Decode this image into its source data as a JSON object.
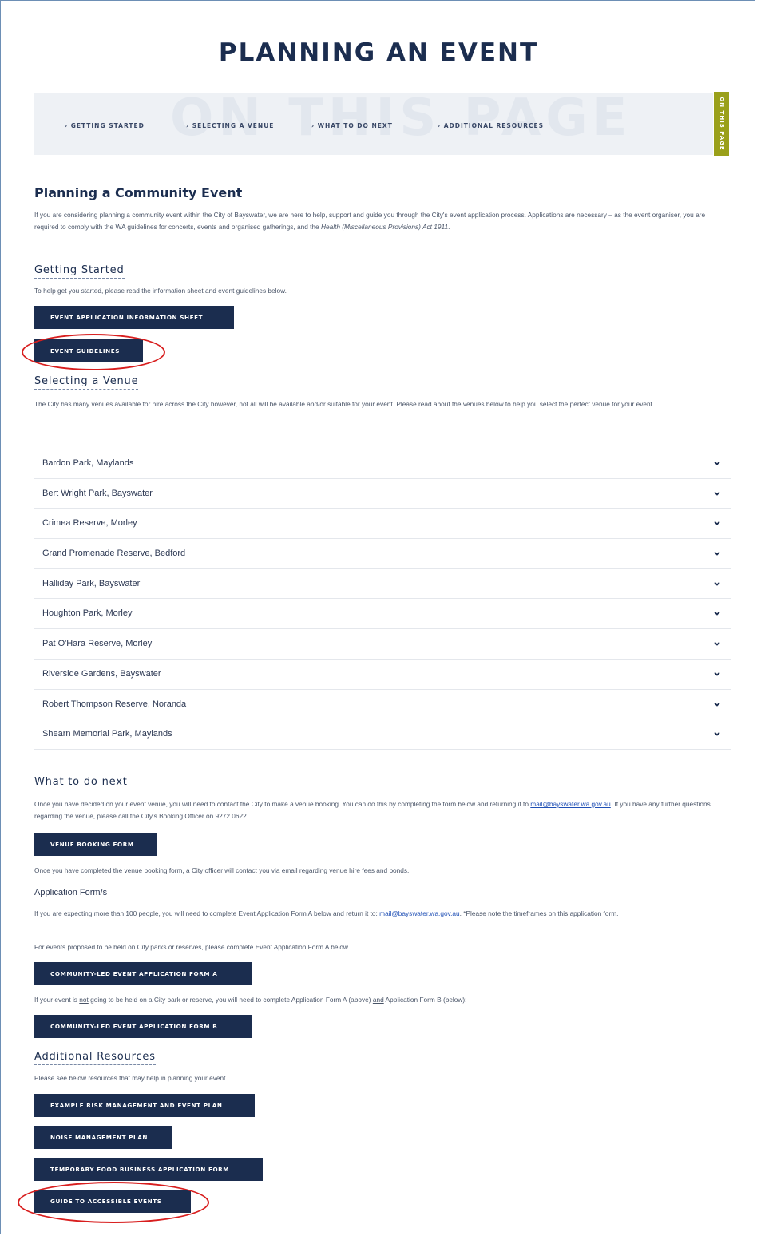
{
  "page": {
    "title": "PLANNING AN EVENT"
  },
  "on_this_page": {
    "ghost_text": "ON THIS PAGE",
    "tab_label": "ON THIS PAGE",
    "links": [
      {
        "label": "› GETTING STARTED"
      },
      {
        "label": "› SELECTING A VENUE"
      },
      {
        "label": "› WHAT TO DO NEXT"
      },
      {
        "label": "› ADDITIONAL RESOURCES"
      }
    ]
  },
  "intro": {
    "heading": "Planning a Community Event",
    "text_1": "If you are considering planning a community event within the City of Bayswater, we are here to help, support and guide you through the City's event application process. Applications are necessary –  as the event organiser, you are required to comply with the WA guidelines for concerts, events and organised gatherings, and the ",
    "text_italic": "Health (Miscellaneous Provisions) Act 1911",
    "text_end": "."
  },
  "getting_started": {
    "heading": "Getting Started",
    "text": "To help get you started, please read the information sheet and event guidelines below.",
    "buttons": [
      {
        "label": "EVENT APPLICATION INFORMATION SHEET"
      },
      {
        "label": "EVENT GUIDELINES"
      }
    ]
  },
  "selecting_venue": {
    "heading": "Selecting a Venue",
    "text": "The City has many venues available for hire across the City however, not all will be available and/or suitable for your event.  Please read about the venues below to help you select the perfect venue for your event.",
    "venues": [
      {
        "label": "Bardon Park, Maylands"
      },
      {
        "label": "Bert Wright Park, Bayswater"
      },
      {
        "label": "Crimea Reserve, Morley"
      },
      {
        "label": "Grand Promenade Reserve, Bedford"
      },
      {
        "label": "Halliday Park, Bayswater"
      },
      {
        "label": "Houghton Park, Morley"
      },
      {
        "label": "Pat O'Hara Reserve, Morley"
      },
      {
        "label": "Riverside Gardens, Bayswater"
      },
      {
        "label": "Robert Thompson Reserve, Noranda"
      },
      {
        "label": "Shearn Memorial Park, Maylands"
      }
    ]
  },
  "what_next": {
    "heading": "What to do next",
    "text_1": "Once you have decided on your event venue, you will need to contact the City to make a venue booking.  You can do this by completing the form below and returning it to ",
    "email": "mail@bayswater.wa.gov.au",
    "text_2": ". If you have any further questions regarding the venue, please call the City's Booking Officer on 9272 0622.",
    "button": "VENUE BOOKING FORM",
    "after_text": "Once you have completed the venue booking form, a City officer will contact you via email regarding venue hire fees and bonds."
  },
  "application_forms": {
    "heading": "Application Form/s",
    "text_1a": "If you are expecting more than 100 people, you will need to complete Event Application Form A below and return it to: ",
    "email": "mail@bayswater.wa.gov.au",
    "text_1b": ".  *Please note the timeframes on this application form.",
    "text_2": "For events proposed to be held on City parks or reserves, please complete Event Application Form A below.",
    "button_a": "COMMUNITY-LED EVENT APPLICATION FORM A",
    "text_3a": "If your event is ",
    "text_3_not": "not",
    "text_3b": " going to be held on a City park or reserve, you will need to complete Application Form A (above) ",
    "text_3_and": "and",
    "text_3c": " Application Form B (below):",
    "button_b": "COMMUNITY-LED EVENT APPLICATION FORM B"
  },
  "additional": {
    "heading": "Additional Resources",
    "text": "Please see below resources that may help in planning your event.",
    "buttons": [
      {
        "label": "EXAMPLE RISK MANAGEMENT AND EVENT PLAN"
      },
      {
        "label": "NOISE MANAGEMENT PLAN"
      },
      {
        "label": "TEMPORARY FOOD BUSINESS APPLICATION FORM"
      },
      {
        "label": "GUIDE TO ACCESSIBLE EVENTS"
      }
    ]
  },
  "colors": {
    "button_bg": "#1b2d4f",
    "tab_bg": "#9aa01a",
    "annotation": "#d81e1e"
  }
}
